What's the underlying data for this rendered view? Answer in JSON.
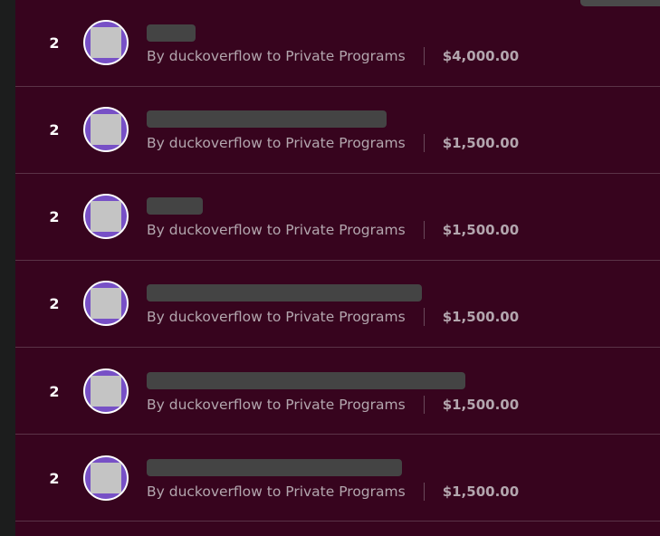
{
  "rows": [
    {
      "rank": "2",
      "byline": "By duckoverflow to Private Programs",
      "amount": "$4,000.00"
    },
    {
      "rank": "2",
      "byline": "By duckoverflow to Private Programs",
      "amount": "$1,500.00"
    },
    {
      "rank": "2",
      "byline": "By duckoverflow to Private Programs",
      "amount": "$1,500.00"
    },
    {
      "rank": "2",
      "byline": "By duckoverflow to Private Programs",
      "amount": "$1,500.00"
    },
    {
      "rank": "2",
      "byline": "By duckoverflow to Private Programs",
      "amount": "$1,500.00"
    },
    {
      "rank": "2",
      "byline": "By duckoverflow to Private Programs",
      "amount": "$1,500.00"
    }
  ]
}
